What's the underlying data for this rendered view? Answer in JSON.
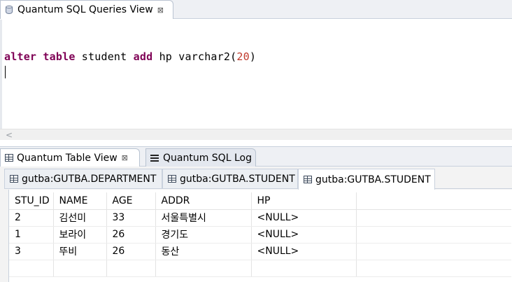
{
  "top_view": {
    "tab_title": "Quantum SQL Queries View",
    "close_glyph": "⊠",
    "sql": {
      "kw_alter": "alter",
      "kw_table": "table",
      "table_name": "student",
      "kw_add": "add",
      "column": "hp",
      "type": "varchar2(",
      "length": "20",
      "close_paren": ")"
    },
    "scroll_arrow": "<"
  },
  "bottom_view": {
    "tabs": [
      {
        "label": "Quantum Table View",
        "close_glyph": "⊠"
      },
      {
        "label": "Quantum SQL Log"
      }
    ],
    "result_tabs": [
      {
        "label": "gutba:GUTBA.DEPARTMENT",
        "active": false
      },
      {
        "label": "gutba:GUTBA.STUDENT",
        "active": false
      },
      {
        "label": "gutba:GUTBA.STUDENT",
        "active": true
      }
    ],
    "table": {
      "columns": [
        "STU_ID",
        "NAME",
        "AGE",
        "ADDR",
        "HP"
      ],
      "rows": [
        [
          "2",
          "김선미",
          "33",
          "서울특별시",
          "<NULL>"
        ],
        [
          "1",
          "보라이",
          "26",
          "경기도",
          "<NULL>"
        ],
        [
          "3",
          "뚜비",
          "26",
          "동산",
          "<NULL>"
        ]
      ]
    }
  },
  "colors": {
    "keyword": "#7f0055",
    "number": "#c0392b",
    "tab_border": "#b9c3d1"
  }
}
